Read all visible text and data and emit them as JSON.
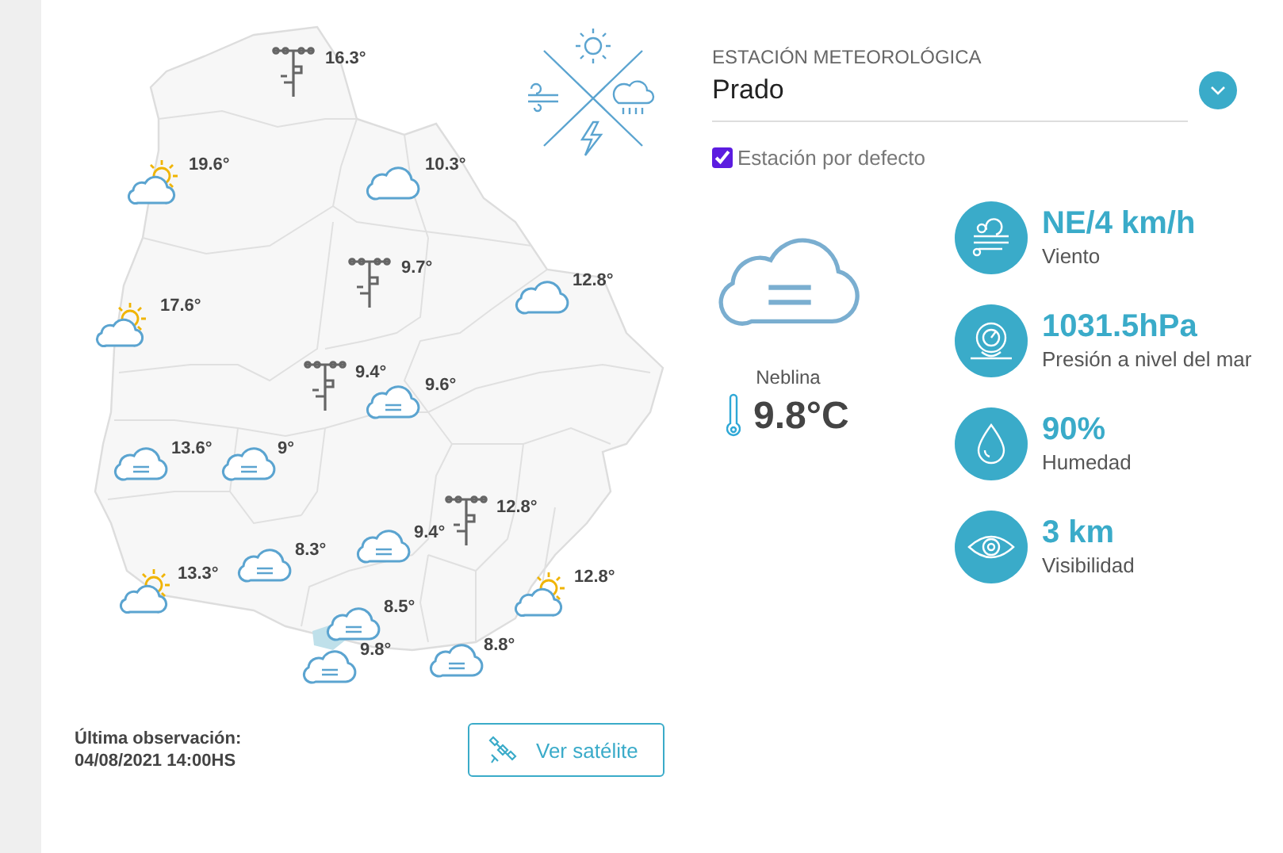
{
  "map": {
    "stations": [
      {
        "kind": "mast",
        "temp": "16.3°"
      },
      {
        "kind": "partly_sunny",
        "temp": "19.6°"
      },
      {
        "kind": "cloudy",
        "temp": "10.3°"
      },
      {
        "kind": "mast",
        "temp": "9.7°"
      },
      {
        "kind": "cloudy",
        "temp": "12.8°"
      },
      {
        "kind": "partly_sunny",
        "temp": "17.6°"
      },
      {
        "kind": "mast",
        "temp": "9.4°"
      },
      {
        "kind": "fog",
        "temp": "9.6°"
      },
      {
        "kind": "fog",
        "temp": "13.6°"
      },
      {
        "kind": "fog",
        "temp": "9°"
      },
      {
        "kind": "mast",
        "temp": "12.8°"
      },
      {
        "kind": "fog",
        "temp": "9.4°"
      },
      {
        "kind": "fog",
        "temp": "8.3°"
      },
      {
        "kind": "partly_sunny",
        "temp": "13.3°"
      },
      {
        "kind": "partly_sunny",
        "temp": "12.8°"
      },
      {
        "kind": "fog",
        "temp": "8.5°"
      },
      {
        "kind": "fog",
        "temp": "9.8°"
      },
      {
        "kind": "fog",
        "temp": "8.8°"
      }
    ]
  },
  "footer": {
    "last_observation_label": "Última observación:",
    "last_observation_time": "04/08/2021 14:00HS",
    "satellite_button": "Ver satélite"
  },
  "station": {
    "label": "ESTACIÓN METEOROLÓGICA",
    "value": "Prado",
    "default_checkbox": {
      "label": "Estación por defecto",
      "checked": true
    }
  },
  "current": {
    "kind": "fog",
    "condition": "Neblina",
    "temperature": "9.8°C"
  },
  "metrics": [
    {
      "kind": "wind",
      "value": "NE/4 km/h",
      "label": "Viento"
    },
    {
      "kind": "pressure",
      "value": "1031.5hPa",
      "label": "Presión a nivel del mar"
    },
    {
      "kind": "humidity",
      "value": "90%",
      "label": "Humedad"
    },
    {
      "kind": "visibility",
      "value": "3 km",
      "label": "Visibilidad"
    }
  ]
}
